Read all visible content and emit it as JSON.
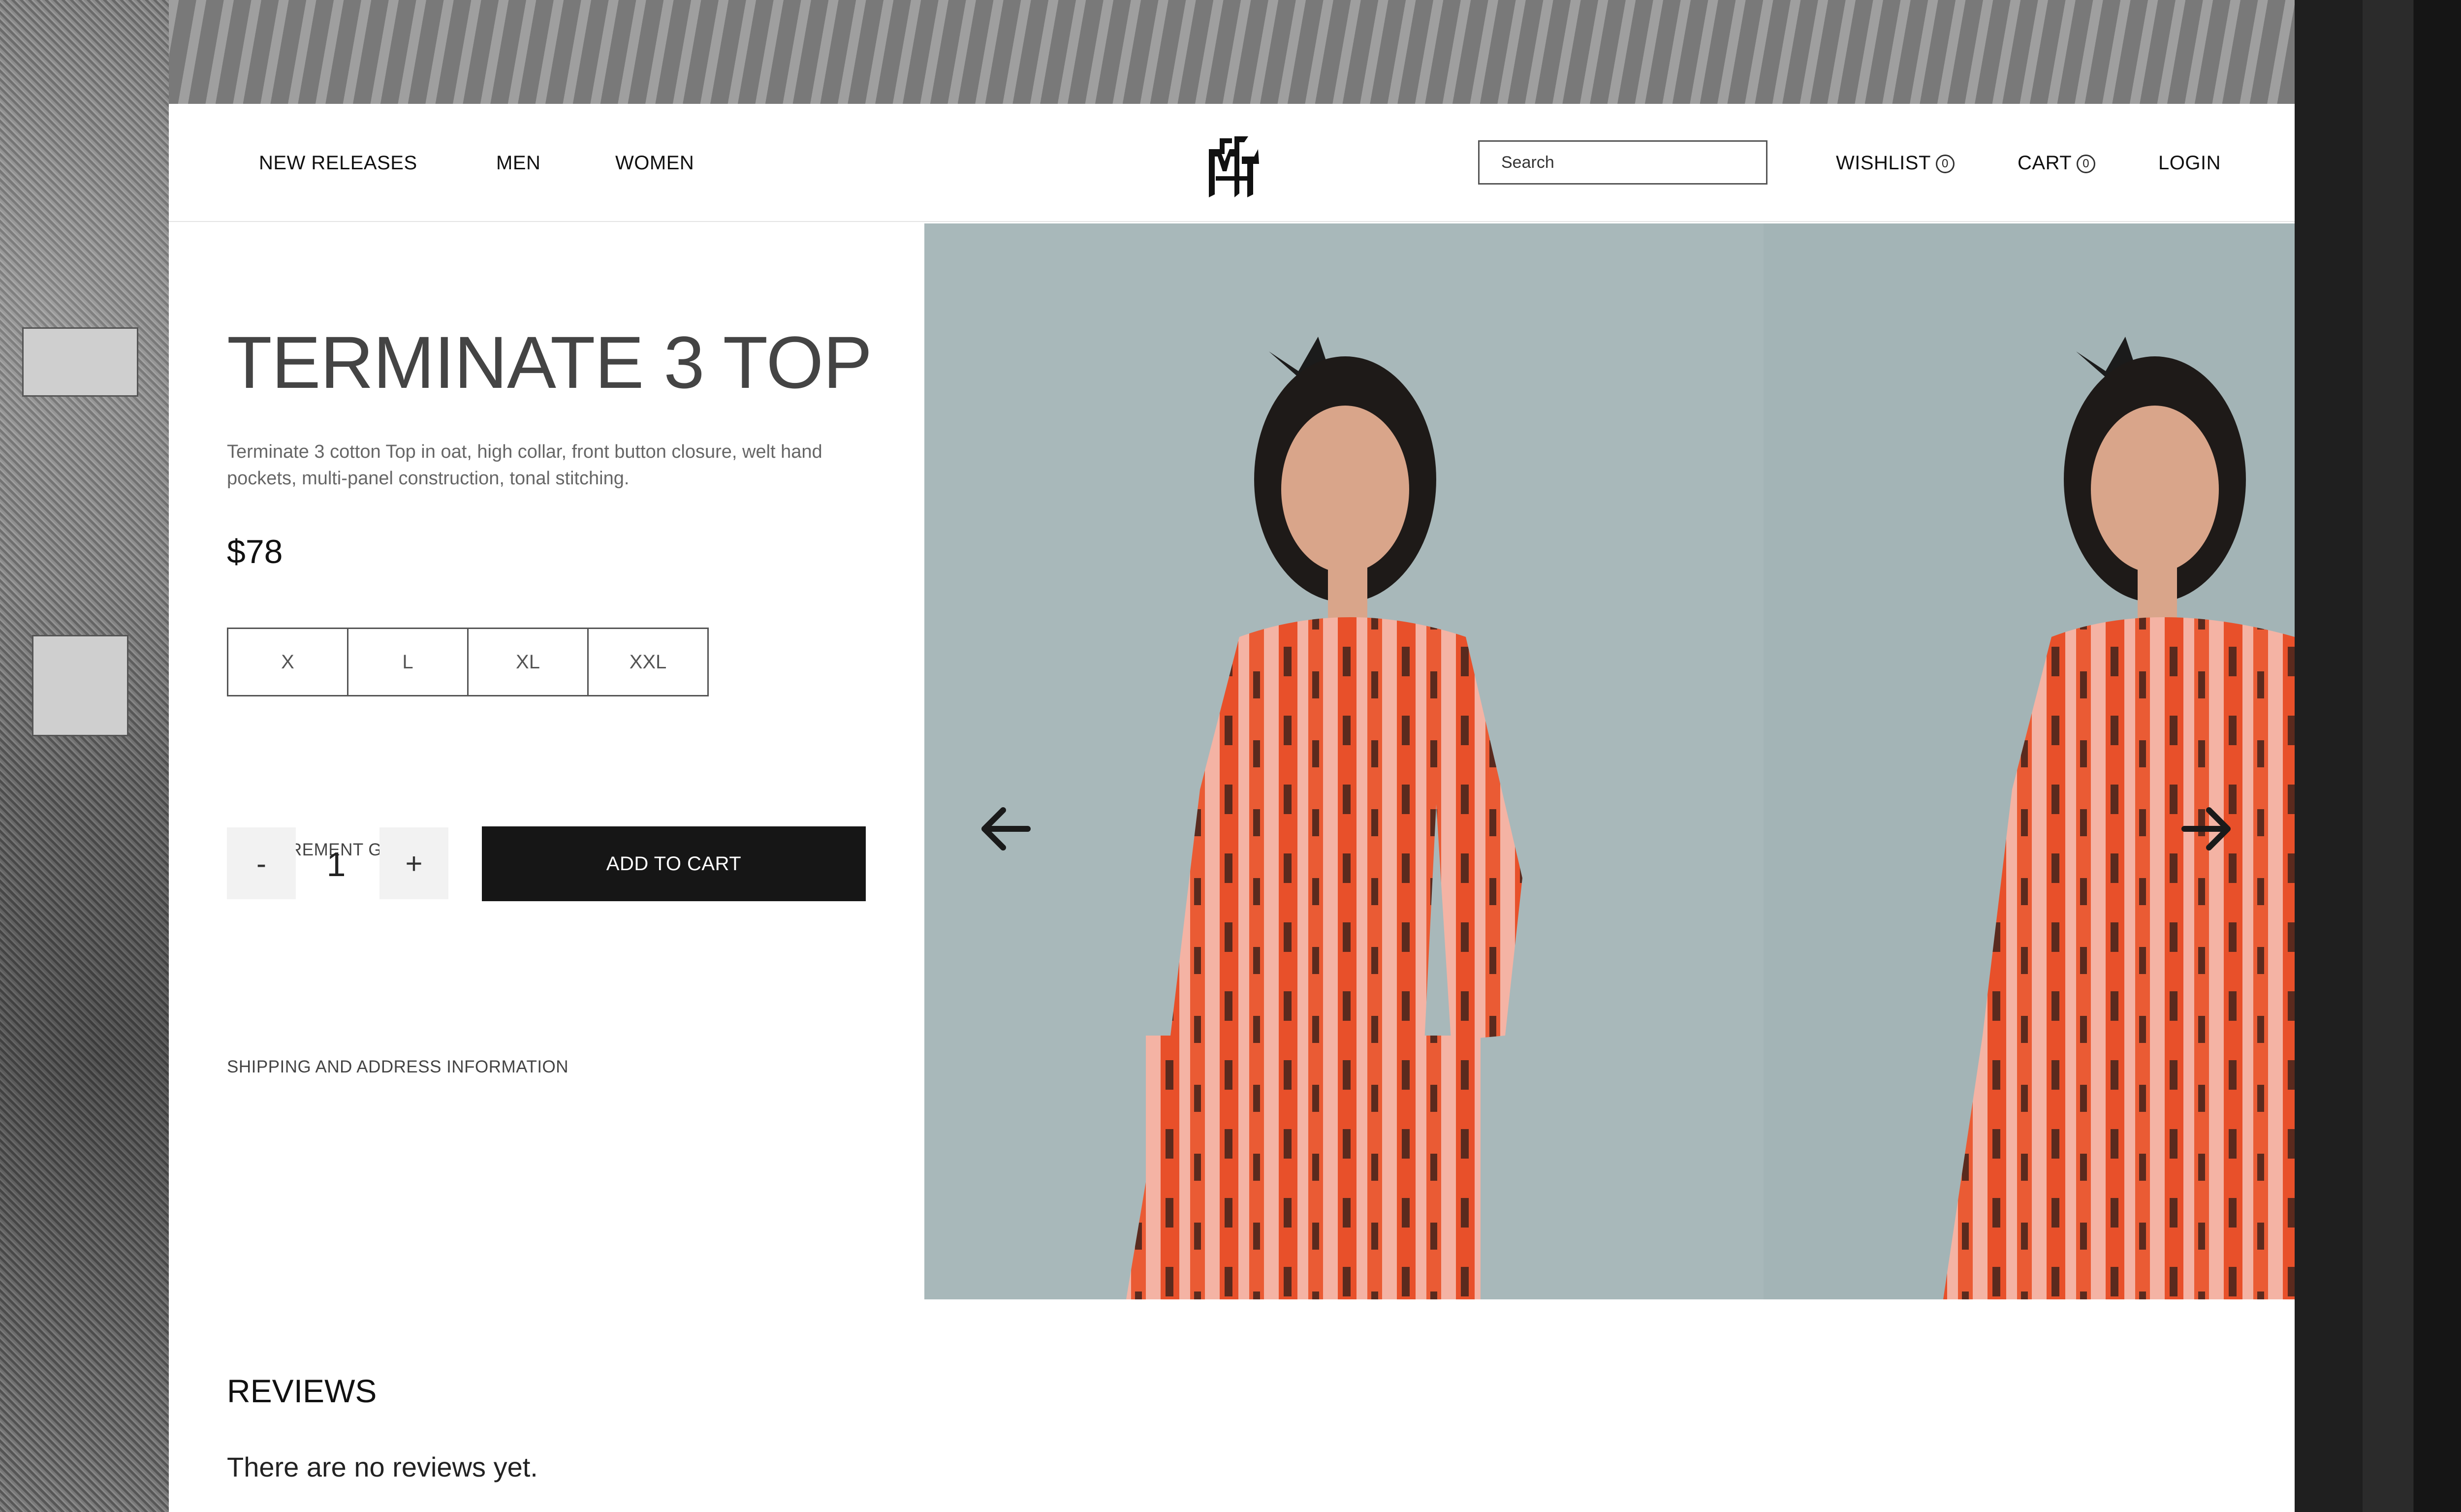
{
  "nav": {
    "links": [
      "NEW RELEASES",
      "MEN",
      "WOMEN"
    ],
    "search_placeholder": "Search",
    "wishlist_label": "WISHLIST",
    "wishlist_count": "0",
    "cart_label": "CART",
    "cart_count": "0",
    "login_label": "LOGIN"
  },
  "product": {
    "title": "TERMINATE 3 TOP",
    "description": "Terminate 3 cotton Top in oat, high collar, front button closure, welt hand pockets, multi-panel construction, tonal stitching.",
    "price": "$78",
    "sizes": [
      "X",
      "L",
      "XL",
      "XXL"
    ],
    "measurement_guide": "MEASUREMENT GUIDE",
    "quantity": "1",
    "decrement_label": "-",
    "increment_label": "+",
    "add_to_cart": "ADD TO CART",
    "shipping_info": "SHIPPING AND ADDRESS INFORMATION"
  },
  "gallery": {
    "background_color": "#a8b8ba",
    "garment_colors": [
      "#e8502a",
      "#f4b3a4",
      "#5a2a1e"
    ]
  },
  "reviews": {
    "title": "REVIEWS",
    "empty_text": "There are no reviews yet."
  }
}
